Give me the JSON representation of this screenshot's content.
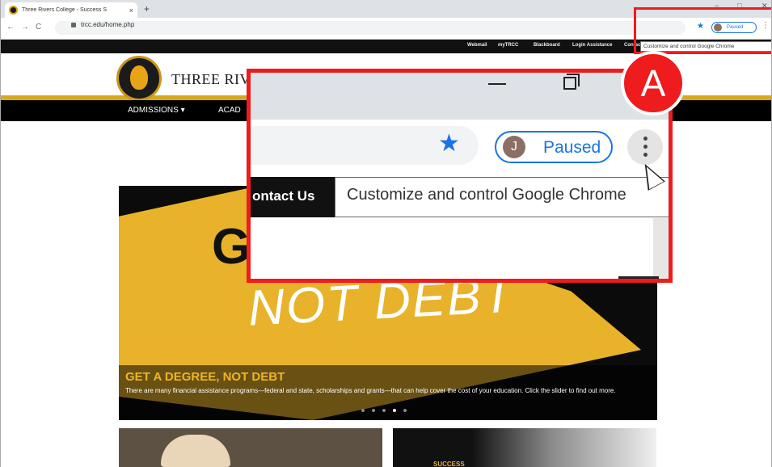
{
  "browser": {
    "tab_title": "Three Rivers College - Success S",
    "tab_close": "×",
    "new_tab": "+",
    "url": "trcc.edu/home.php",
    "paused_label": "Paused",
    "profile_initial": "J",
    "back": "←",
    "forward": "→",
    "reload": "C",
    "bookmark_star": "★",
    "menu_kebab": "⋮",
    "window_minimize": "−",
    "window_maximize": "□",
    "window_close": "✕"
  },
  "site": {
    "top_links": [
      "Webmail",
      "myTRCC",
      "Blackboard",
      "Login Assistance",
      "Contact Us"
    ],
    "brand_name": "THREE RIV",
    "nav": [
      "ADMISSIONS ▾",
      "ACAD"
    ],
    "hero": {
      "big_letter": "G",
      "headline": "NOT DEBT",
      "title": "GET A DEGREE, NOT DEBT",
      "subtitle": "There are many financial assistance programs—federal and state, scholarships and grants—that can help cover the cost of your education. Click the slider to find out more.",
      "slide_count": 5,
      "active_slide": 4
    },
    "card2_label": "SUCCESS"
  },
  "tooltip": {
    "text": "Customize and control Google Chrome"
  },
  "zoom": {
    "contact_text": "ontact Us",
    "tooltip_text": "Customize and control Google Chrome",
    "paused_label": "Paused",
    "profile_initial": "J"
  },
  "callout": {
    "label": "A",
    "color": "#ee1c1c"
  },
  "colors": {
    "gold": "#e8b32a",
    "chrome_blue": "#1a73e8",
    "black": "#111111"
  }
}
